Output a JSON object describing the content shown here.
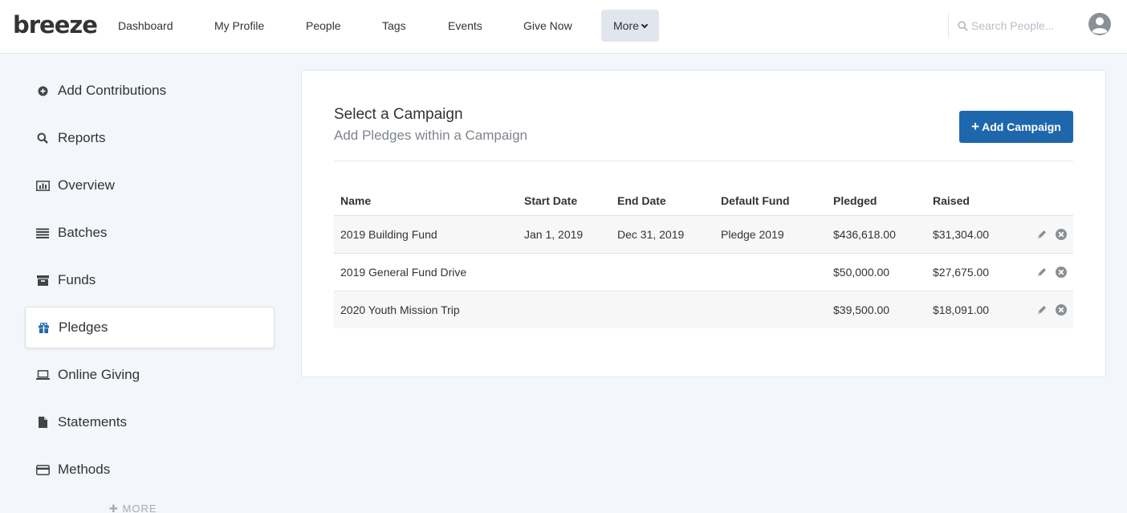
{
  "app": {
    "logo": "breeze"
  },
  "nav": {
    "items": [
      {
        "label": "Dashboard"
      },
      {
        "label": "My Profile"
      },
      {
        "label": "People"
      },
      {
        "label": "Tags"
      },
      {
        "label": "Events"
      },
      {
        "label": "Give Now"
      }
    ],
    "more_label": "More",
    "search_placeholder": "Search People..."
  },
  "sidebar": {
    "items": [
      {
        "label": "Add Contributions",
        "icon": "plus-circle-icon"
      },
      {
        "label": "Reports",
        "icon": "search-icon"
      },
      {
        "label": "Overview",
        "icon": "bar-chart-icon"
      },
      {
        "label": "Batches",
        "icon": "list-icon"
      },
      {
        "label": "Funds",
        "icon": "archive-icon"
      },
      {
        "label": "Pledges",
        "icon": "gift-icon",
        "active": true
      },
      {
        "label": "Online Giving",
        "icon": "laptop-icon"
      },
      {
        "label": "Statements",
        "icon": "file-icon"
      },
      {
        "label": "Methods",
        "icon": "credit-card-icon"
      }
    ],
    "more_label": "MORE"
  },
  "main": {
    "title": "Select a Campaign",
    "subtitle": "Add Pledges within a Campaign",
    "add_button_label": "Add Campaign",
    "columns": [
      "Name",
      "Start Date",
      "End Date",
      "Default Fund",
      "Pledged",
      "Raised"
    ],
    "rows": [
      {
        "name": "2019 Building Fund",
        "start": "Jan 1, 2019",
        "end": "Dec 31, 2019",
        "fund": "Pledge 2019",
        "pledged": "$436,618.00",
        "raised": "$31,304.00"
      },
      {
        "name": "2019 General Fund Drive",
        "start": "",
        "end": "",
        "fund": "",
        "pledged": "$50,000.00",
        "raised": "$27,675.00"
      },
      {
        "name": "2020 Youth Mission Trip",
        "start": "",
        "end": "",
        "fund": "",
        "pledged": "$39,500.00",
        "raised": "$18,091.00"
      }
    ]
  },
  "colors": {
    "accent": "#1f67ad",
    "active_icon": "#1f67ad",
    "background": "#f3f6fa"
  }
}
